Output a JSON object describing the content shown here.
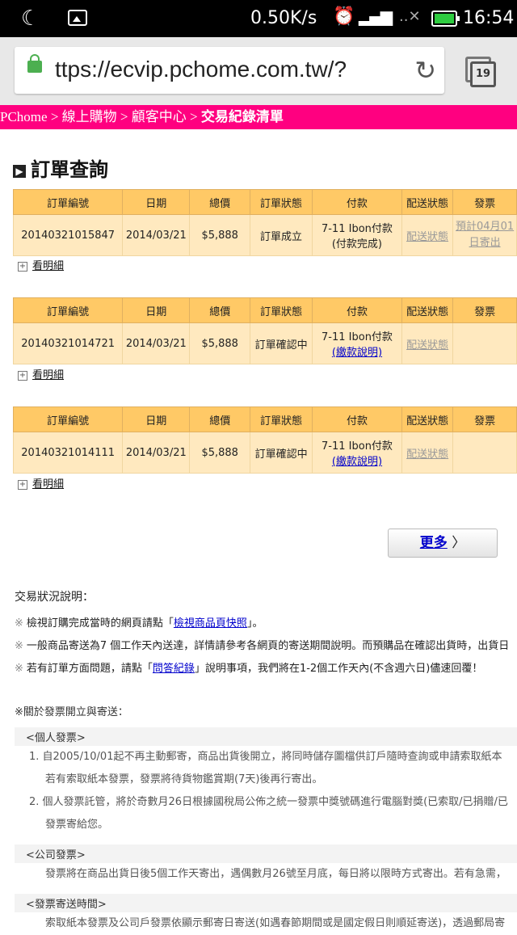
{
  "status": {
    "speed": "0.50K/s",
    "time": "16:54"
  },
  "browser": {
    "url": "ttps://ecvip.pchome.com.tw/?",
    "tab_count": "19"
  },
  "breadcrumb": {
    "a": "PChome",
    "b": "線上購物",
    "c": "顧客中心",
    "current": "交易紀錄清單",
    "sep": " > "
  },
  "page_title": "訂單查詢",
  "headers": [
    "訂單編號",
    "日期",
    "總價",
    "訂單狀態",
    "付款",
    "配送狀態",
    "發票"
  ],
  "orders": [
    {
      "id": "20140321015847",
      "date": "2014/03/21",
      "total": "$5,888",
      "status": "訂單成立",
      "pay1": "7-11 Ibon付款",
      "pay2": "(付款完成)",
      "ship": "配送狀態",
      "invoice": "預計04月01日寄出"
    },
    {
      "id": "20140321014721",
      "date": "2014/03/21",
      "total": "$5,888",
      "status": "訂單確認中",
      "pay1": "7-11 Ibon付款",
      "pay2": "(繳款說明)",
      "ship": "配送狀態",
      "invoice": ""
    },
    {
      "id": "20140321014111",
      "date": "2014/03/21",
      "total": "$5,888",
      "status": "訂單確認中",
      "pay1": "7-11 Ibon付款",
      "pay2": "(繳款說明)",
      "ship": "配送狀態",
      "invoice": ""
    }
  ],
  "detail_label": "看明細",
  "more_label": "更多",
  "notes": {
    "heading": "交易狀況說明：",
    "l1a": "檢視訂購完成當時的網頁請點「",
    "l1link": "檢視商品頁快照",
    "l1b": "」。",
    "l2": "一般商品寄送為7 個工作天內送達，詳情請參考各網頁的寄送期間說明。而預購品在確認出貨時，出貨日",
    "l3a": "若有訂單方面問題，請點「",
    "l3link": "問答紀錄",
    "l3b": "」說明事項，我們將在1-2個工作天內(不含週六日)儘速回覆！"
  },
  "invoice": {
    "heading": "關於發票開立與寄送：",
    "personal": "<個人發票>",
    "p1a": "1.  自2005/10/01起不再主動郵寄，商品出貨後開立，將同時儲存圖檔供訂戶隨時查詢或申請索取紙本",
    "p1b": "若有索取紙本發票，發票將待貨物鑑賞期(7天)後再行寄出。",
    "p2a": "2.  個人發票託管，將於奇數月26日根據國稅局公佈之統一發票中獎號碼進行電腦對獎(已索取/已捐贈/已",
    "p2b": "發票寄給您。",
    "company": "<公司發票>",
    "c1": "發票將在商品出貨日後5個工作天寄出，遇偶數月26號至月底，每日將以限時方式寄出。若有急需，",
    "timing": "<發票寄送時間>",
    "t1": "索取紙本發票及公司戶發票依顯示郵寄日寄送(如遇春節期間或是國定假日則順延寄送)，透過郵局寄"
  }
}
